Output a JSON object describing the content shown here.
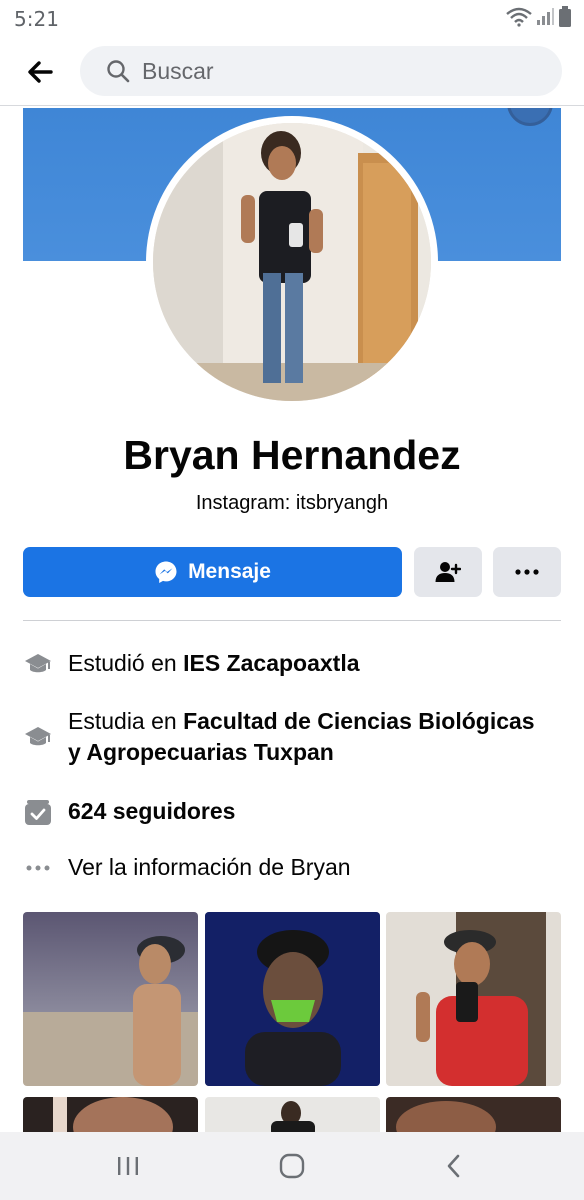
{
  "status_bar": {
    "time": "5:21"
  },
  "search": {
    "placeholder": "Buscar"
  },
  "profile": {
    "name": "Bryan Hernandez",
    "bio": "Instagram: itsbryangh"
  },
  "actions": {
    "message_label": "Mensaje"
  },
  "info": [
    {
      "prefix": "Estudió en ",
      "bold": "IES Zacapoaxtla",
      "icon": "graduation-cap-icon"
    },
    {
      "prefix": "Estudia en ",
      "bold": "Facultad de Ciencias Biológicas y Agropecuarias Tuxpan",
      "icon": "graduation-cap-icon"
    },
    {
      "prefix": "",
      "bold": "624 seguidores",
      "icon": "followers-icon"
    },
    {
      "prefix": "Ver la información de Bryan",
      "bold": "",
      "icon": "more-dots-icon"
    }
  ],
  "colors": {
    "accent": "#1b74e4",
    "cover": "#4a8fdc",
    "button_grey": "#e4e6eb"
  }
}
